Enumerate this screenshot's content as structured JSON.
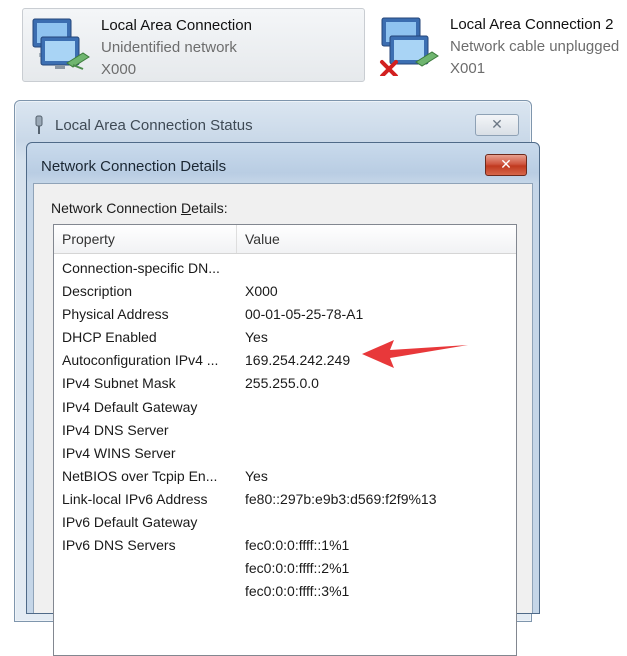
{
  "adapters": [
    {
      "name": "Local Area Connection",
      "status": "Unidentified network",
      "device": "X000",
      "disconnected": false
    },
    {
      "name": "Local Area Connection 2",
      "status": "Network cable unplugged",
      "device": "X001",
      "disconnected": true
    }
  ],
  "status_window": {
    "title": "Local Area Connection Status",
    "close_glyph": "✕"
  },
  "details_window": {
    "title": "Network Connection Details",
    "close_glyph": "✕",
    "group_label_prefix": "Network Connection ",
    "group_label_underlined": "D",
    "group_label_suffix": "etails:",
    "columns": {
      "property": "Property",
      "value": "Value"
    },
    "rows": [
      {
        "property": "Connection-specific DN...",
        "value": ""
      },
      {
        "property": "Description",
        "value": "X000"
      },
      {
        "property": "Physical Address",
        "value": "00-01-05-25-78-A1"
      },
      {
        "property": "DHCP Enabled",
        "value": "Yes"
      },
      {
        "property": "Autoconfiguration IPv4 ...",
        "value": "169.254.242.249"
      },
      {
        "property": "IPv4 Subnet Mask",
        "value": "255.255.0.0"
      },
      {
        "property": "IPv4 Default Gateway",
        "value": ""
      },
      {
        "property": "IPv4 DNS Server",
        "value": ""
      },
      {
        "property": "IPv4 WINS Server",
        "value": ""
      },
      {
        "property": "NetBIOS over Tcpip En...",
        "value": "Yes"
      },
      {
        "property": "Link-local IPv6 Address",
        "value": "fe80::297b:e9b3:d569:f2f9%13"
      },
      {
        "property": "IPv6 Default Gateway",
        "value": ""
      },
      {
        "property": "IPv6 DNS Servers",
        "value": "fec0:0:0:ffff::1%1"
      },
      {
        "property": "",
        "value": "fec0:0:0:ffff::2%1"
      },
      {
        "property": "",
        "value": "fec0:0:0:ffff::3%1"
      }
    ]
  },
  "colors": {
    "arrow": "#e8383a",
    "close_active": "#c7402a",
    "title_blue": "#b9cde3"
  }
}
